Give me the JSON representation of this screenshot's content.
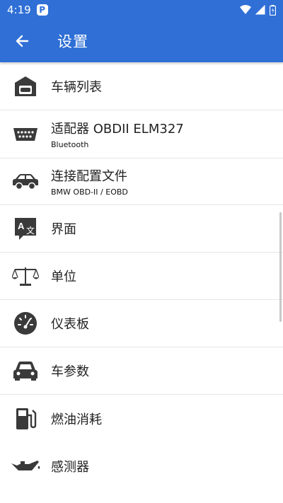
{
  "status": {
    "time": "4:19",
    "notification": "P"
  },
  "header": {
    "title": "设置"
  },
  "settings": [
    {
      "label": "车辆列表",
      "sub": ""
    },
    {
      "label": "适配器 OBDII ELM327",
      "sub": "Bluetooth"
    },
    {
      "label": "连接配置文件",
      "sub": "BMW OBD-II / EOBD"
    },
    {
      "label": "界面",
      "sub": ""
    },
    {
      "label": "单位",
      "sub": ""
    },
    {
      "label": "仪表板",
      "sub": ""
    },
    {
      "label": "车参数",
      "sub": ""
    },
    {
      "label": "燃油消耗",
      "sub": ""
    },
    {
      "label": "感测器",
      "sub": ""
    }
  ],
  "colors": {
    "accent": "#2f6fd6",
    "icon": "#3a3a3a"
  }
}
